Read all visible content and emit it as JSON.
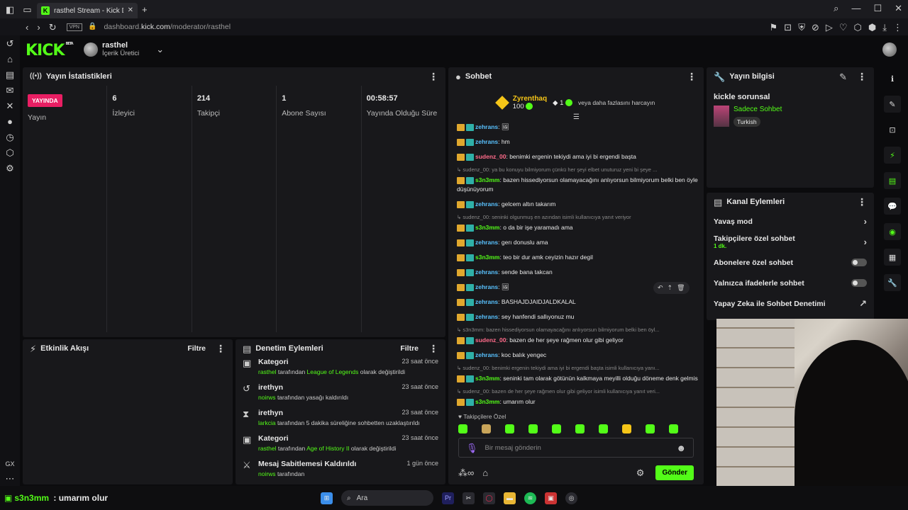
{
  "browser": {
    "tab_title": "rasthel Stream - Kick Das",
    "url_prefix": "dashboard.",
    "url_domain": "kick.com",
    "url_path": "/moderator/rasthel",
    "vpn": "VPN"
  },
  "header": {
    "logo": "KICK",
    "beta": "BETA",
    "username": "rasthel",
    "role": "İçerik Üretici"
  },
  "stats": {
    "title": "Yayın İstatistikleri",
    "live_badge": "YAYINDA",
    "items": [
      {
        "value": "",
        "label": "Yayın"
      },
      {
        "value": "6",
        "label": "İzleyici"
      },
      {
        "value": "214",
        "label": "Takipçi"
      },
      {
        "value": "1",
        "label": "Abone Sayısı"
      },
      {
        "value": "00:58:57",
        "label": "Yayında Olduğu Süre"
      }
    ]
  },
  "activity": {
    "title": "Etkinlik Akışı",
    "filter": "Filtre"
  },
  "moderation": {
    "title": "Denetim Eylemleri",
    "filter": "Filtre",
    "items": [
      {
        "title": "Kategori",
        "time": "23 saat önce",
        "user": "rasthel",
        "mid": "tarafından",
        "value": "League of Legends",
        "end": "olarak değiştirildi"
      },
      {
        "title": "irethyn",
        "time": "23 saat önce",
        "user": "noirws",
        "mid": "tarafından yasağı kaldırıldı",
        "value": "",
        "end": ""
      },
      {
        "title": "irethyn",
        "time": "23 saat önce",
        "user": "larkcia",
        "mid": "tarafından 5 dakika süreliğine sohbetten uzaklaştırıldı",
        "value": "",
        "end": ""
      },
      {
        "title": "Kategori",
        "time": "23 saat önce",
        "user": "rasthel",
        "mid": "tarafından",
        "value": "Age of History II",
        "end": "olarak değiştirildi"
      },
      {
        "title": "Mesaj Sabitlemesi Kaldırıldı",
        "time": "1 gün önce",
        "user": "noirws",
        "mid": "tarafından",
        "value": "",
        "end": ""
      }
    ]
  },
  "chat": {
    "title": "Sohbet",
    "pinned": {
      "name": "Zyrenthaq",
      "amount": "100",
      "count": "1",
      "text": "veya daha fazlasını harcayın"
    },
    "messages": [
      {
        "type": "msg",
        "user": "zehrans",
        "color": "nb",
        "text": "🖼"
      },
      {
        "type": "msg",
        "user": "zehrans",
        "color": "nb",
        "text": "hm"
      },
      {
        "type": "msg",
        "user": "sudenz_00",
        "color": "np",
        "text": "benimki ergenin tekiydi ama iyi bi ergendi başta"
      },
      {
        "type": "reply",
        "text": "sudenz_00: ya bu konuyu bilmiyorum çünkü her şeyi elbet unuturuz yeni bi şeye ..."
      },
      {
        "type": "msg",
        "user": "s3n3mm",
        "color": "ng",
        "text": "bazen hissediyorsun olamayacağını anlıyorsun bilmiyorum belki ben öyle düşünüyorum"
      },
      {
        "type": "msg",
        "user": "zehrans",
        "color": "nb",
        "text": "gelcem altın takarım"
      },
      {
        "type": "reply",
        "text": "sudenz_00: seninki olgunmuş en azından isimli kullanıcıya yanıt veriyor"
      },
      {
        "type": "msg",
        "user": "s3n3mm",
        "color": "ng",
        "text": "o da bir işe yaramadı ama"
      },
      {
        "type": "msg",
        "user": "zehrans",
        "color": "nb",
        "text": "gerı donuslu ama"
      },
      {
        "type": "msg",
        "user": "s3n3mm",
        "color": "ng",
        "text": "teo bir dur amk ceyizin hazır degil"
      },
      {
        "type": "msg",
        "user": "zehrans",
        "color": "nb",
        "text": "sende bana takcan"
      },
      {
        "type": "msg",
        "user": "zehrans",
        "color": "nb",
        "text": "🖼"
      },
      {
        "type": "msg",
        "user": "zehrans",
        "color": "nb",
        "text": "BASHAJDJAIDJALDKALAL"
      },
      {
        "type": "msg",
        "user": "zehrans",
        "color": "nb",
        "text": "sey hanfendi sallıyonuz mu"
      },
      {
        "type": "reply",
        "text": "s3n3mm: bazen hissediyorsun olamayacağını anlıyorsun bilmiyorum belki ben öyl..."
      },
      {
        "type": "msg",
        "user": "sudenz_00",
        "color": "np",
        "text": "bazen de her şeye rağmen olur gibi geliyor"
      },
      {
        "type": "msg",
        "user": "zehrans",
        "color": "nb",
        "text": "koc balık yengec"
      },
      {
        "type": "reply",
        "text": "sudenz_00: benimki ergenin tekiydi ama iyi bi ergendi başta isimli kullanıcıya yanı..."
      },
      {
        "type": "msg",
        "user": "s3n3mm",
        "color": "ng",
        "text": "seninki tam olarak götünün kalkmaya meyilli olduğu döneme denk gelmis"
      },
      {
        "type": "reply",
        "text": "sudenz_00: bazen de her şeye rağmen olur gibi geliyor isimli kullanıcıya yanıt veri..."
      },
      {
        "type": "msg",
        "user": "s3n3mm",
        "color": "ng",
        "text": "umarım olur"
      }
    ],
    "followers_only": "Takipçilere Özel",
    "input_placeholder": "Bir mesaj gönderin",
    "send": "Gönder"
  },
  "info": {
    "title": "Yayın bilgisi",
    "stream_title": "kickle sorunsal",
    "category": "Sadece Sohbet",
    "tag": "Turkish"
  },
  "channel_actions": {
    "title": "Kanal Eylemleri",
    "items": [
      {
        "label": "Yavaş mod",
        "sub": "",
        "control": "arrow"
      },
      {
        "label": "Takipçilere özel sohbet",
        "sub": "1 dk.",
        "control": "arrow"
      },
      {
        "label": "Abonelere özel sohbet",
        "sub": "",
        "control": "toggle"
      },
      {
        "label": "Yalnızca ifadelerle sohbet",
        "sub": "",
        "control": "toggle"
      },
      {
        "label": "Yapay Zeka ile Sohbet Denetimi",
        "sub": "",
        "control": "ext"
      }
    ]
  },
  "caption": {
    "user": "s3n3mm",
    "text": "umarım olur"
  },
  "taskbar": {
    "search": "Ara"
  }
}
